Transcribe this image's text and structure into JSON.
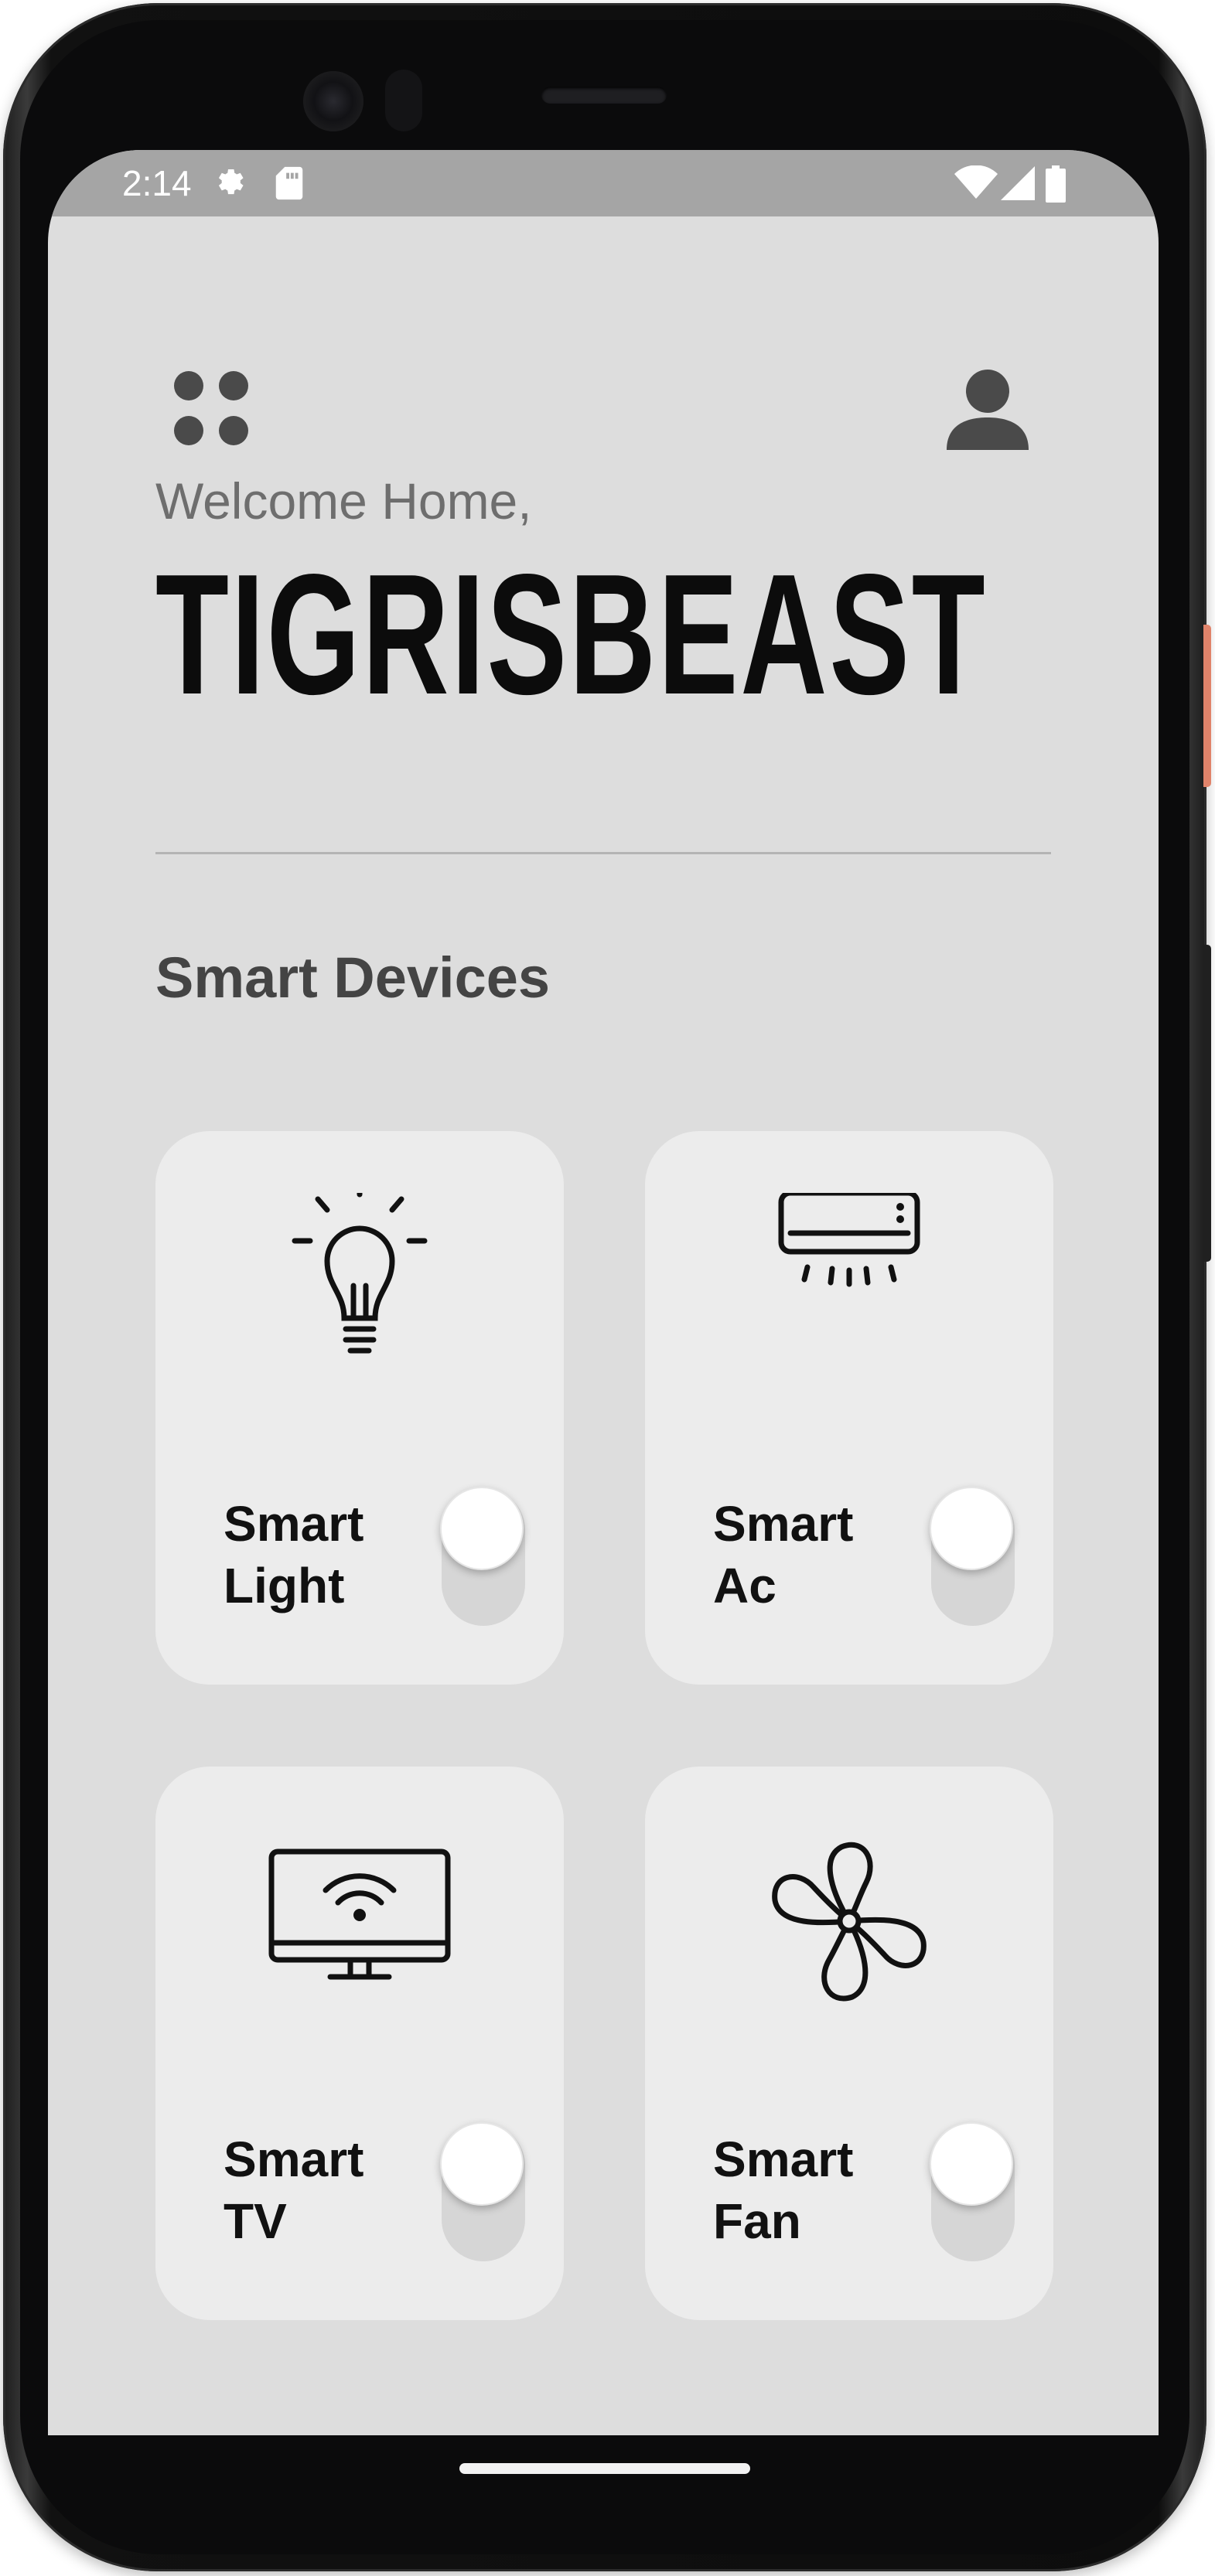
{
  "status_bar": {
    "time": "2:14",
    "icons": [
      "settings-gear-icon",
      "sd-card-icon",
      "wifi-icon",
      "cell-signal-icon",
      "battery-icon"
    ]
  },
  "header": {
    "menu_icon": "grid-dots-icon",
    "profile_icon": "person-icon",
    "welcome": "Welcome Home,",
    "username": "TIGRISBEAST"
  },
  "section_title": "Smart Devices",
  "devices": [
    {
      "line1": "Smart",
      "line2": "Light",
      "icon": "lightbulb-icon",
      "on": false
    },
    {
      "line1": "Smart",
      "line2": "Ac",
      "icon": "air-conditioner-icon",
      "on": false
    },
    {
      "line1": "Smart",
      "line2": "TV",
      "icon": "smart-tv-icon",
      "on": false
    },
    {
      "line1": "Smart",
      "line2": "Fan",
      "icon": "fan-icon",
      "on": false
    }
  ],
  "colors": {
    "screen_bg": "#dddddd",
    "card_bg": "#ececec",
    "status_bar": "#a5a5a5",
    "title": "#0c0c0c",
    "power_button": "#e0836a"
  }
}
